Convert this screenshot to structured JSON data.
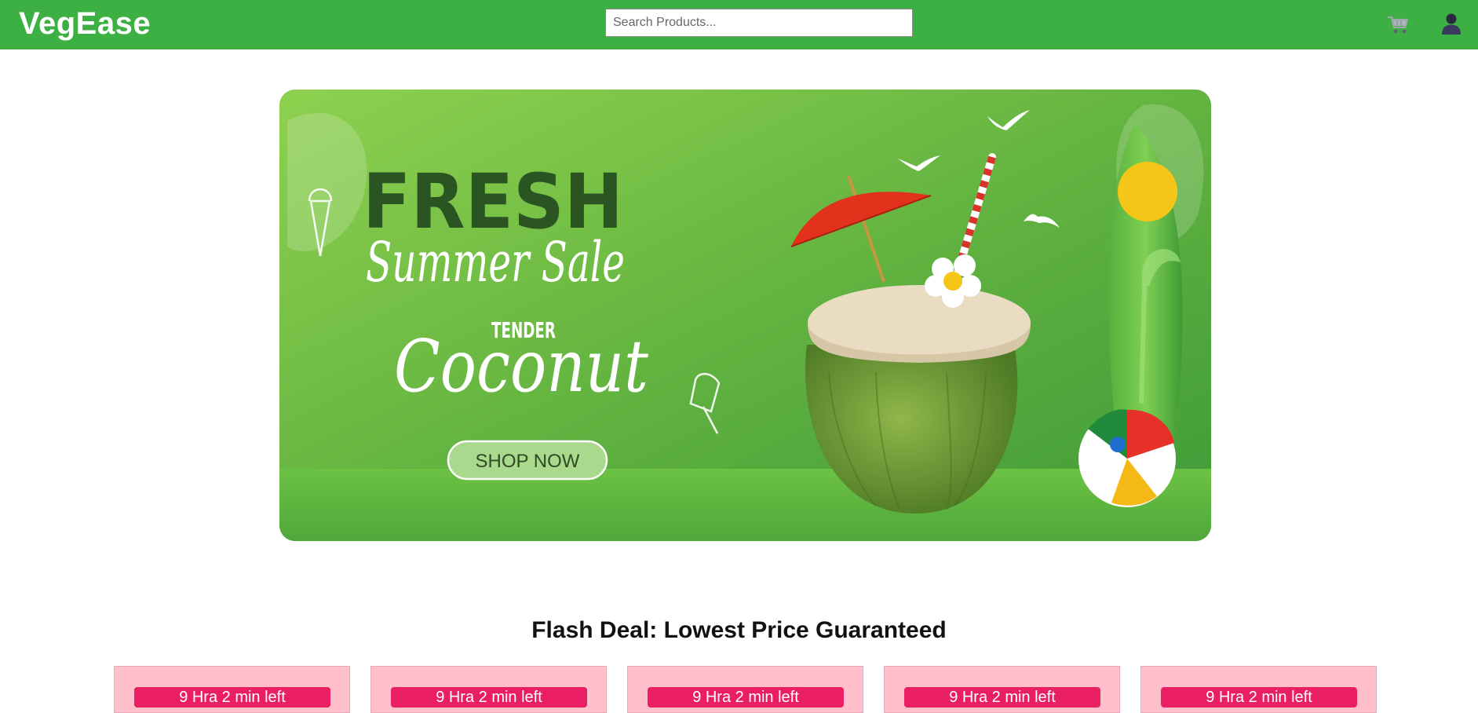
{
  "header": {
    "logo": "VegEase",
    "search": {
      "placeholder": "Search Products...",
      "value": ""
    },
    "icons": [
      "cart-icon",
      "user-icon"
    ],
    "bg_color": "#3cb043"
  },
  "banner": {
    "headline": "FRESH",
    "subheadline": "Summer Sale",
    "product_prefix": "TENDER",
    "product": "Coconut",
    "cta": "SHOP NOW",
    "bg_color": "#6bbf46"
  },
  "flash_deal": {
    "title": "Flash Deal: Lowest Price Guaranteed",
    "cards": [
      {
        "timer": "9 Hra 2 min left"
      },
      {
        "timer": "9 Hra 2 min left"
      },
      {
        "timer": "9 Hra 2 min left"
      },
      {
        "timer": "9 Hra 2 min left"
      },
      {
        "timer": "9 Hra 2 min left"
      }
    ],
    "card_color": "#ffc0cb",
    "timer_color": "#e91e63"
  }
}
